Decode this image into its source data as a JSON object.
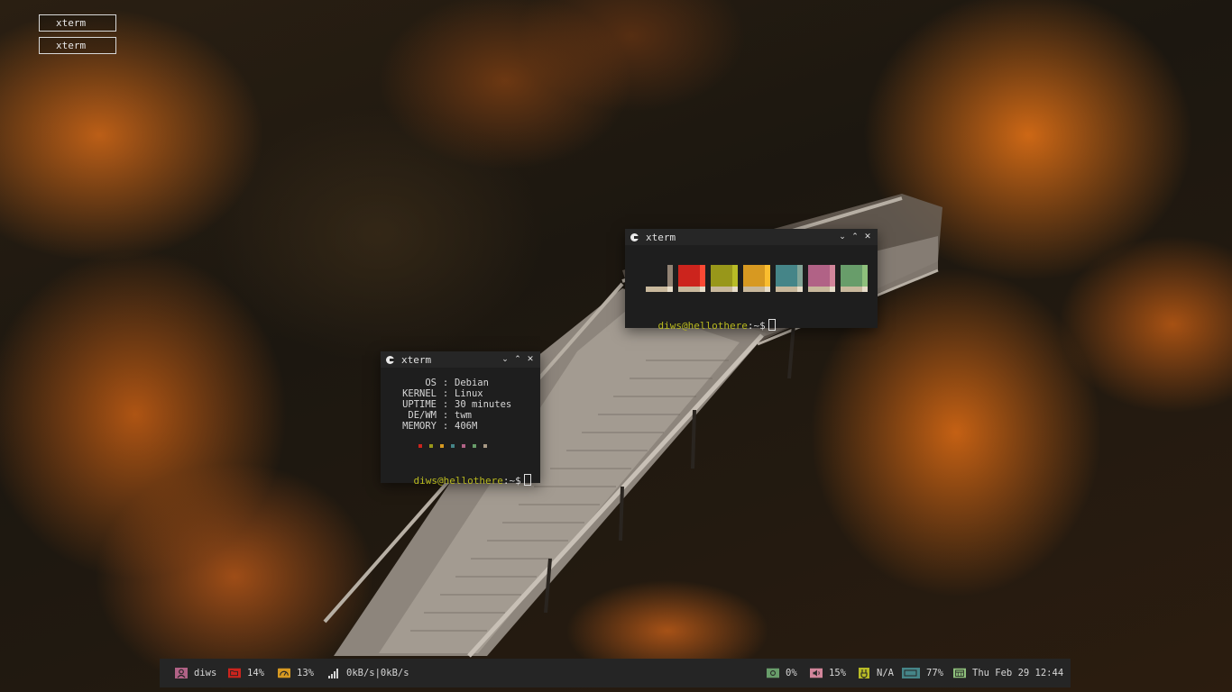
{
  "taskbar": {
    "items": [
      {
        "label": "xterm"
      },
      {
        "label": "xterm"
      }
    ]
  },
  "windows": {
    "colors": {
      "title": "xterm",
      "palette": [
        {
          "main": "#282828",
          "bright": "#928374"
        },
        {
          "main": "#cc241d",
          "bright": "#fb4934"
        },
        {
          "main": "#98971a",
          "bright": "#b8bb26"
        },
        {
          "main": "#d79921",
          "bright": "#fabd2f"
        },
        {
          "main": "#458588",
          "bright": "#83a598"
        },
        {
          "main": "#b16286",
          "bright": "#d3869b"
        },
        {
          "main": "#689d6a",
          "bright": "#8ec07c"
        }
      ],
      "prompt": {
        "user_host": "diws@hellothere",
        "path": ":~",
        "symbol": "$"
      }
    },
    "info": {
      "title": "xterm",
      "rows": [
        {
          "key": "OS",
          "value": "Debian"
        },
        {
          "key": "KERNEL",
          "value": "Linux"
        },
        {
          "key": "UPTIME",
          "value": "30 minutes"
        },
        {
          "key": "DE/WM",
          "value": "twm"
        },
        {
          "key": "MEMORY",
          "value": "406M"
        }
      ],
      "dot_colors": [
        "#cc241d",
        "#98971a",
        "#d79921",
        "#458588",
        "#b16286",
        "#689d6a",
        "#a89984"
      ],
      "prompt": {
        "user_host": "diws@hellothere",
        "path": ":~",
        "symbol": "$"
      }
    }
  },
  "statusbar": {
    "user": {
      "icon": "user-icon",
      "text": "diws",
      "color": "#b16286"
    },
    "disk": {
      "icon": "folder-icon",
      "text": "14%",
      "color": "#cc241d"
    },
    "cpu": {
      "icon": "cpu-gauge-icon",
      "text": "13%",
      "color": "#d79921"
    },
    "net": {
      "icon": "signal-icon",
      "text": "0kB/s|0kB/s",
      "color": "#d6d6d6"
    },
    "brightness": {
      "icon": "brightness-icon",
      "text": "0%",
      "color": "#689d6a"
    },
    "volume": {
      "icon": "volume-icon",
      "text": "15%",
      "color": "#d3869b"
    },
    "battery_status": {
      "icon": "power-icon",
      "text": "N/A",
      "color": "#b8bb26"
    },
    "battery": {
      "icon": "battery-icon",
      "text": "77%",
      "color": "#458588"
    },
    "clock": {
      "icon": "calendar-icon",
      "text": "Thu Feb 29 12:44",
      "color": "#8ec07c"
    }
  }
}
